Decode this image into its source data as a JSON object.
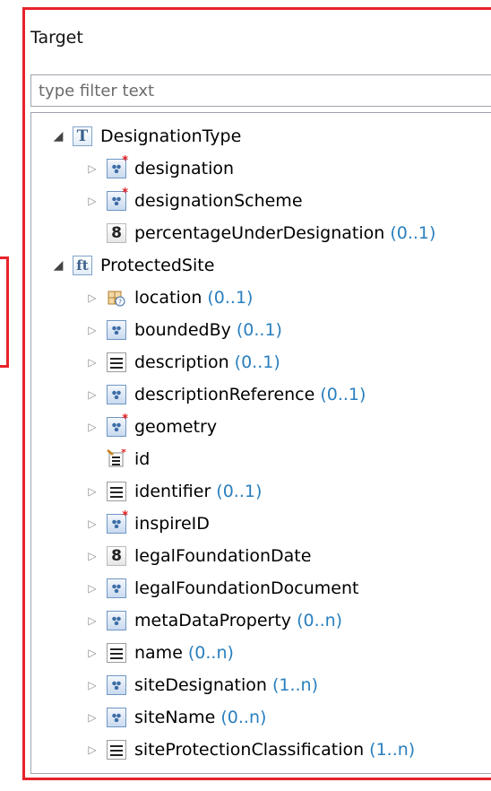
{
  "panel": {
    "title": "Target",
    "filter_placeholder": "type filter text"
  },
  "colors": {
    "highlight_border": "#e8222a",
    "cardinality": "#2a7fbf"
  },
  "tree": [
    {
      "label": "DesignationType",
      "card": "",
      "icon": "type-T-icon",
      "toggle": "expanded"
    },
    {
      "label": "designation",
      "card": "",
      "icon": "complex-required-icon",
      "toggle": "collapsed"
    },
    {
      "label": "designationScheme",
      "card": "",
      "icon": "complex-required-icon",
      "toggle": "collapsed"
    },
    {
      "label": "percentageUnderDesignation",
      "card": "(0..1)",
      "icon": "number-8-icon",
      "toggle": "none"
    },
    {
      "label": "ProtectedSite",
      "card": "",
      "icon": "feature-type-ft-icon",
      "toggle": "expanded"
    },
    {
      "label": "location",
      "card": "(0..1)",
      "icon": "location-choice-icon",
      "toggle": "collapsed"
    },
    {
      "label": "boundedBy",
      "card": "(0..1)",
      "icon": "complex-icon",
      "toggle": "collapsed"
    },
    {
      "label": "description",
      "card": "(0..1)",
      "icon": "text-lines-icon",
      "toggle": "collapsed"
    },
    {
      "label": "descriptionReference",
      "card": "(0..1)",
      "icon": "complex-icon",
      "toggle": "collapsed"
    },
    {
      "label": "geometry",
      "card": "",
      "icon": "complex-required-icon",
      "toggle": "collapsed"
    },
    {
      "label": "id",
      "card": "",
      "icon": "id-attribute-icon",
      "toggle": "none"
    },
    {
      "label": "identifier",
      "card": "(0..1)",
      "icon": "text-lines-icon",
      "toggle": "collapsed"
    },
    {
      "label": "inspireID",
      "card": "",
      "icon": "complex-required-icon",
      "toggle": "collapsed"
    },
    {
      "label": "legalFoundationDate",
      "card": "",
      "icon": "number-8-icon",
      "toggle": "collapsed"
    },
    {
      "label": "legalFoundationDocument",
      "card": "",
      "icon": "complex-icon",
      "toggle": "collapsed"
    },
    {
      "label": "metaDataProperty",
      "card": "(0..n)",
      "icon": "complex-icon",
      "toggle": "collapsed"
    },
    {
      "label": "name",
      "card": "(0..n)",
      "icon": "text-lines-icon",
      "toggle": "collapsed"
    },
    {
      "label": "siteDesignation",
      "card": "(1..n)",
      "icon": "complex-icon",
      "toggle": "collapsed"
    },
    {
      "label": "siteName",
      "card": "(0..n)",
      "icon": "complex-icon",
      "toggle": "collapsed"
    },
    {
      "label": "siteProtectionClassification",
      "card": "(1..n)",
      "icon": "text-lines-icon",
      "toggle": "collapsed"
    }
  ]
}
